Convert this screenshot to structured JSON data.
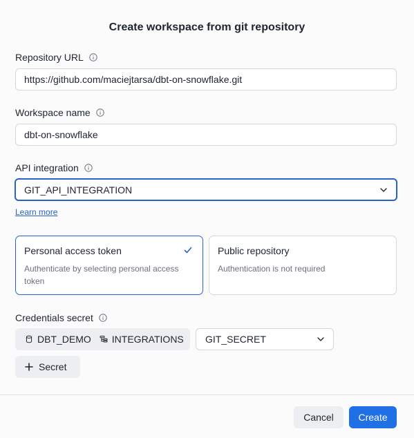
{
  "dialog": {
    "title": "Create workspace from git repository"
  },
  "repository_url": {
    "label": "Repository URL",
    "value": "https://github.com/maciejtarsa/dbt-on-snowflake.git"
  },
  "workspace_name": {
    "label": "Workspace name",
    "value": "dbt-on-snowflake"
  },
  "api_integration": {
    "label": "API integration",
    "selected": "GIT_API_INTEGRATION",
    "learn_more": "Learn more"
  },
  "auth_options": [
    {
      "title": "Personal access token",
      "description": "Authenticate by selecting personal access token",
      "selected": true
    },
    {
      "title": "Public repository",
      "description": "Authentication is not required",
      "selected": false
    }
  ],
  "credentials_secret": {
    "label": "Credentials secret",
    "database": "DBT_DEMO",
    "schema": "INTEGRATIONS",
    "secret": "GIT_SECRET",
    "add_label": "Secret"
  },
  "footer": {
    "cancel_label": "Cancel",
    "create_label": "Create"
  },
  "colors": {
    "accent": "#1f6fe5",
    "focus_border": "#2563c9",
    "border": "#d3d6dc",
    "muted_text": "#6b717c",
    "chip_bg": "#eceef1"
  }
}
